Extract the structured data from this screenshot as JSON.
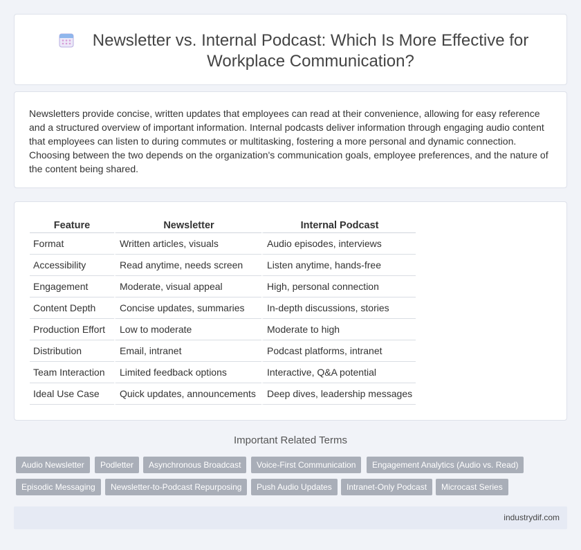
{
  "header": {
    "title": "Newsletter vs. Internal Podcast: Which Is More Effective for Workplace Communication?",
    "icon": "calendar-icon"
  },
  "intro": "Newsletters provide concise, written updates that employees can read at their convenience, allowing for easy reference and a structured overview of important information. Internal podcasts deliver information through engaging audio content that employees can listen to during commutes or multitasking, fostering a more personal and dynamic connection. Choosing between the two depends on the organization's communication goals, employee preferences, and the nature of the content being shared.",
  "table": {
    "headers": [
      "Feature",
      "Newsletter",
      "Internal Podcast"
    ],
    "rows": [
      [
        "Format",
        "Written articles, visuals",
        "Audio episodes, interviews"
      ],
      [
        "Accessibility",
        "Read anytime, needs screen",
        "Listen anytime, hands-free"
      ],
      [
        "Engagement",
        "Moderate, visual appeal",
        "High, personal connection"
      ],
      [
        "Content Depth",
        "Concise updates, summaries",
        "In-depth discussions, stories"
      ],
      [
        "Production Effort",
        "Low to moderate",
        "Moderate to high"
      ],
      [
        "Distribution",
        "Email, intranet",
        "Podcast platforms, intranet"
      ],
      [
        "Team Interaction",
        "Limited feedback options",
        "Interactive, Q&A potential"
      ],
      [
        "Ideal Use Case",
        "Quick updates, announcements",
        "Deep dives, leadership messages"
      ]
    ]
  },
  "terms": {
    "title": "Important Related Terms",
    "tags": [
      "Audio Newsletter",
      "Podletter",
      "Asynchronous Broadcast",
      "Voice-First Communication",
      "Engagement Analytics (Audio vs. Read)",
      "Episodic Messaging",
      "Newsletter-to-Podcast Repurposing",
      "Push Audio Updates",
      "Intranet-Only Podcast",
      "Microcast Series"
    ]
  },
  "footer": {
    "site": "industrydif.com"
  },
  "colors": {
    "background": "#f1f3f8",
    "tag": "#a9aeb8",
    "footer": "#e6eaf4"
  }
}
